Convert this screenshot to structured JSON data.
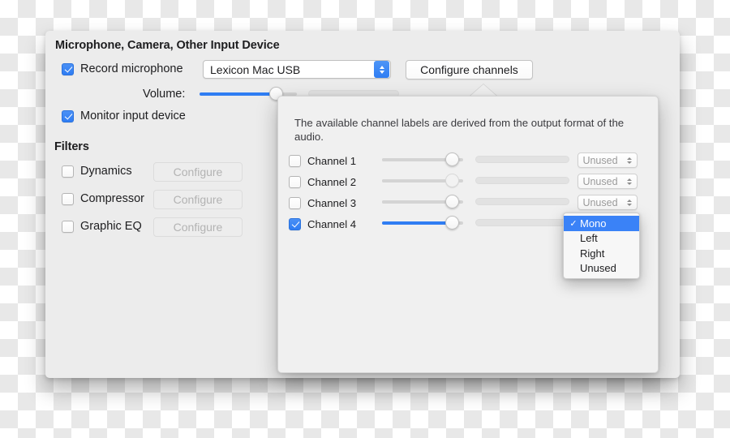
{
  "window": {
    "section_title": "Microphone, Camera, Other Input Device"
  },
  "record": {
    "checkbox_label": "Record microphone",
    "checked": true,
    "device_value": "Lexicon Mac USB",
    "configure_channels_label": "Configure channels"
  },
  "volume": {
    "label": "Volume:",
    "value_percent": 78
  },
  "monitor": {
    "checkbox_label": "Monitor input device",
    "checked": true
  },
  "filters": {
    "title": "Filters",
    "configure_label": "Configure",
    "items": [
      {
        "label": "Dynamics",
        "checked": false,
        "button_enabled": false
      },
      {
        "label": "Compressor",
        "checked": false,
        "button_enabled": false
      },
      {
        "label": "Graphic EQ",
        "checked": false,
        "button_enabled": false
      }
    ]
  },
  "popover": {
    "description": "The available channel labels are derived from the output format of the audio.",
    "channels": [
      {
        "label": "Channel 1",
        "checked": false,
        "slider_percent": 86,
        "assignment": "Unused"
      },
      {
        "label": "Channel 2",
        "checked": false,
        "slider_percent": 86,
        "assignment": "Unused"
      },
      {
        "label": "Channel 3",
        "checked": false,
        "slider_percent": 86,
        "assignment": "Unused"
      },
      {
        "label": "Channel 4",
        "checked": true,
        "slider_percent": 86,
        "assignment": "Mono"
      }
    ]
  },
  "channel_menu": {
    "selected": "Mono",
    "check_glyph": "✓",
    "options": [
      {
        "label": "Mono",
        "selected": true
      },
      {
        "label": "Left",
        "selected": false
      },
      {
        "label": "Right",
        "selected": false
      },
      {
        "label": "Unused",
        "selected": false
      }
    ]
  },
  "colors": {
    "accent_blue": "#2f7df3",
    "menu_highlight": "#3a82f7",
    "window_bg": "#ececec",
    "popover_bg": "#f0f0f0"
  }
}
